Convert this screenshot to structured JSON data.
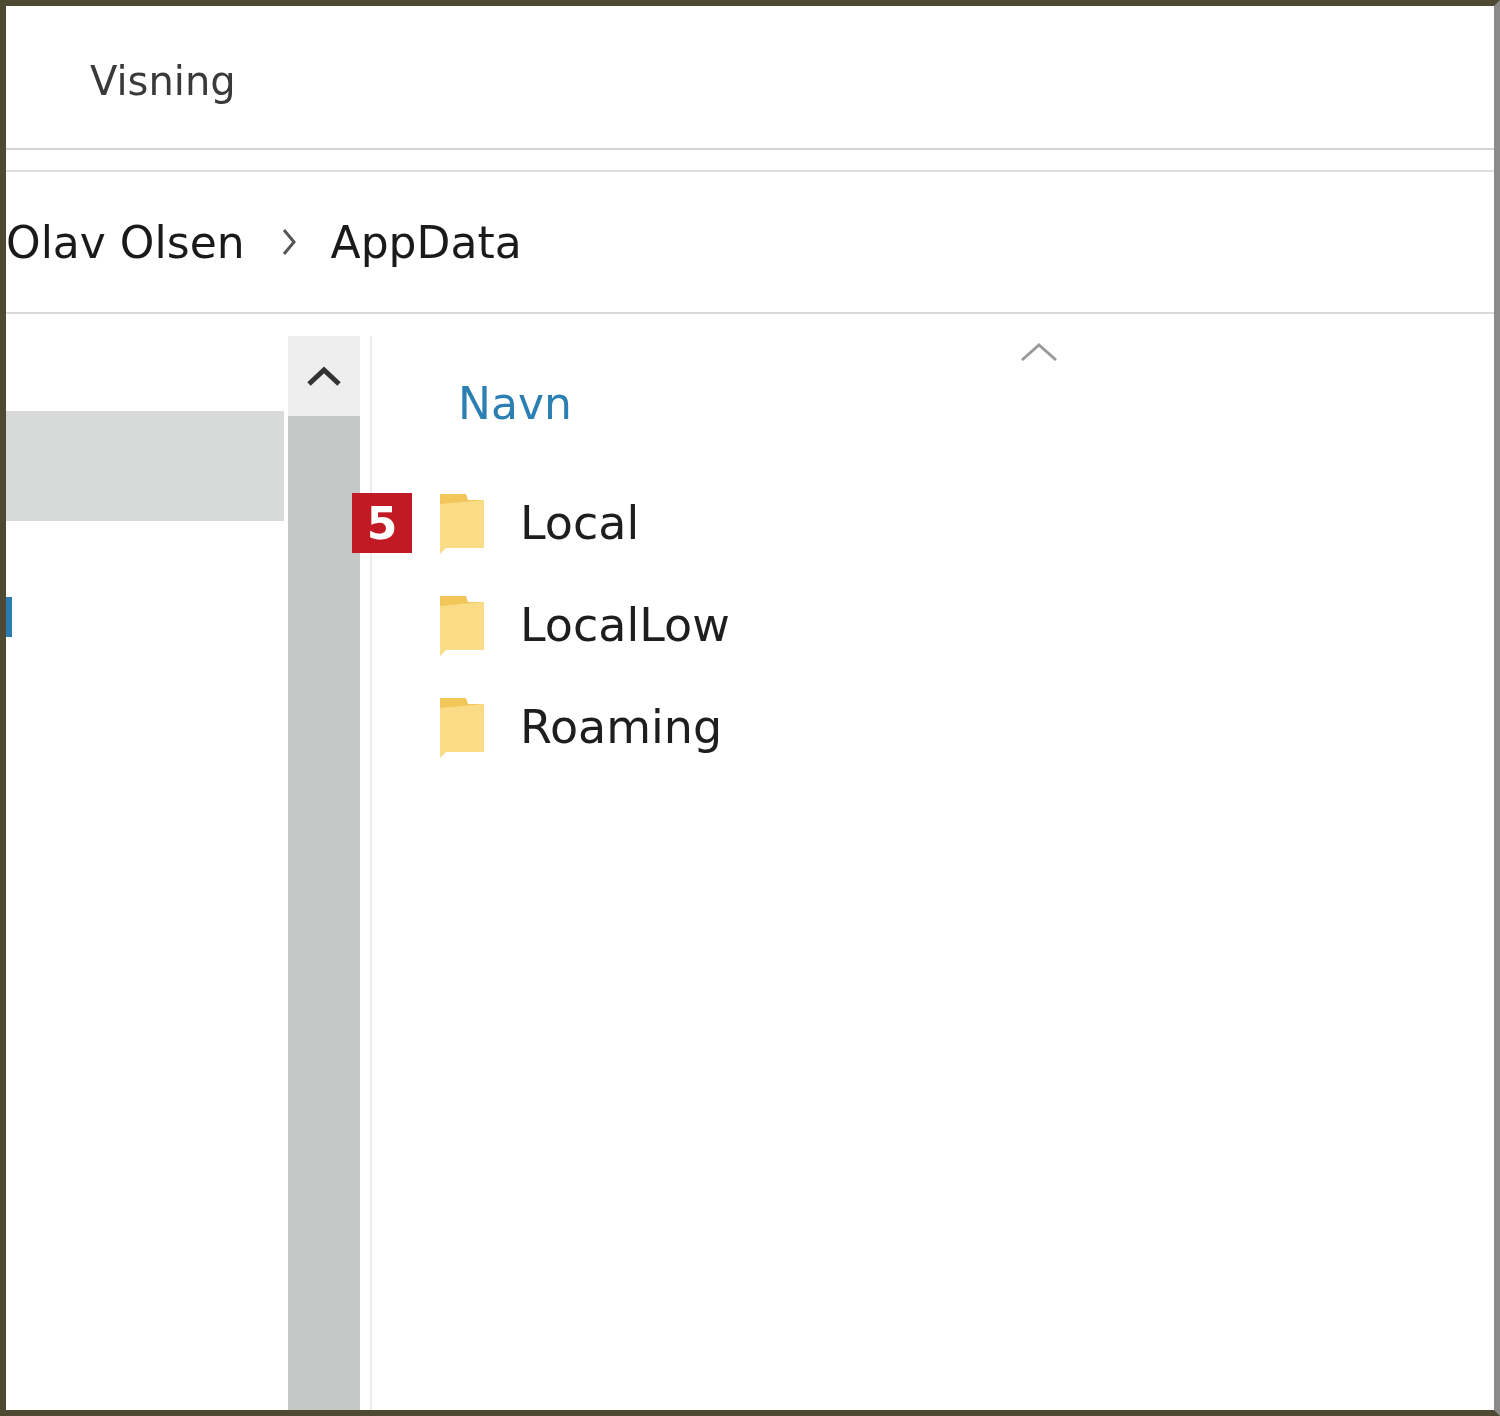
{
  "ribbon": {
    "tabs": [
      {
        "label": "Visning"
      }
    ]
  },
  "address_bar": {
    "crumbs": [
      "Olav Olsen",
      "AppData"
    ]
  },
  "file_list": {
    "column": {
      "label": "Navn",
      "sort_ascending": true
    },
    "items": [
      {
        "name": "Local",
        "badge": "5"
      },
      {
        "name": "LocalLow"
      },
      {
        "name": "Roaming"
      }
    ]
  }
}
